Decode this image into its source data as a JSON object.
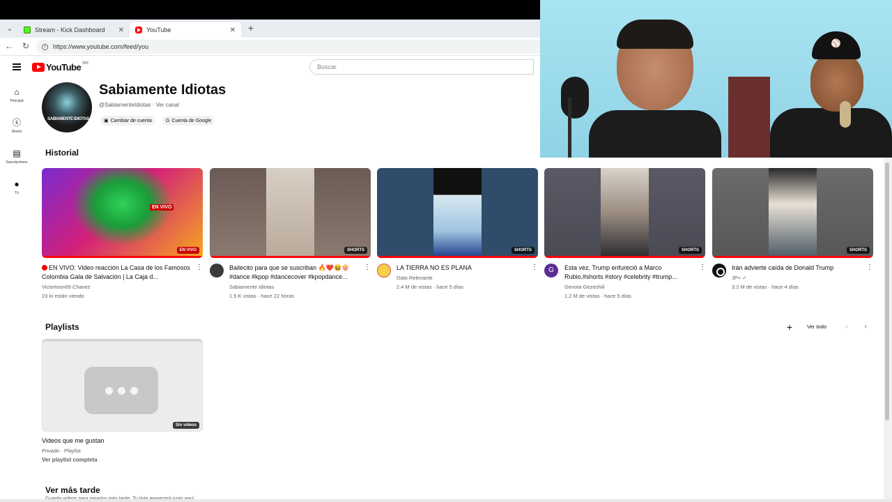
{
  "browser": {
    "tabs": [
      {
        "label": "Stream - Kick Dashboard",
        "active": false,
        "icon": "kick-favicon"
      },
      {
        "label": "YouTube",
        "active": true,
        "icon": "youtube-favicon"
      }
    ],
    "url": "https://www.youtube.com/feed/you"
  },
  "header": {
    "logo_text": "YouTube",
    "region": "MX",
    "search_placeholder": "Buscar"
  },
  "guide": {
    "items": [
      {
        "label": "Principal",
        "icon": "home-icon",
        "glyph": "⌂"
      },
      {
        "label": "Shorts",
        "icon": "shorts-icon",
        "glyph": "ⓢ"
      },
      {
        "label": "Suscripciones",
        "icon": "subscriptions-icon",
        "glyph": "▤"
      },
      {
        "label": "Tú",
        "icon": "account-icon",
        "glyph": "●"
      }
    ]
  },
  "channel": {
    "name": "Sabiamente Idiotas",
    "handle": "@SabiamenteIdiotas · Ver canal",
    "avatar_text": "SABIAMENTE IDIOTAS",
    "switch_account": "Cambiar de cuenta",
    "google_account": "Cuenta de Google"
  },
  "history": {
    "title": "Historial",
    "videos": [
      {
        "title": "EN VIVO: Video reacción La Casa de los Famosos Colombia Gala de Salvación | La Caja d...",
        "channel": "Victortoon69 Chavez",
        "meta": "23 lo están viendo",
        "badge": "EN VIVO",
        "thumb_top_text": "EN VIVO",
        "live": true,
        "progress_percent": 100
      },
      {
        "title": "Bailecito para que se suscriban 🔥❤️😆🍿 #dance #kpop #dancecover #kpopdance...",
        "channel": "Sabiamente Idiotas",
        "meta": "1.5 K vistas · hace 22 horas",
        "badge": "SHORTS",
        "live": false,
        "progress_percent": 100
      },
      {
        "title": "LA TIERRA NO ES PLANA",
        "channel": "Dato Relevante",
        "meta": "2.4 M de vistas · hace 5 días",
        "badge": "SHORTS",
        "live": false,
        "progress_percent": 100
      },
      {
        "title": "Esta vez, Trump enfureció a Marco Rubio.#shorts #story #celebrity #trump...",
        "channel": "Genota Gezeshili",
        "meta": "1.2 M de vistas · hace 5 días",
        "avatar_letter": "G",
        "badge": "SHORTS",
        "live": false,
        "progress_percent": 100
      },
      {
        "title": "Irán advierte caída de Donald Trump",
        "channel": "JP+ ✓",
        "meta": "3.2 M de vistas · hace 4 días",
        "badge": "SHORTS",
        "live": false,
        "progress_percent": 100
      }
    ]
  },
  "playlists": {
    "title": "Playlists",
    "view_all": "Ver todo",
    "items": [
      {
        "title": "Videos que me gustan",
        "meta": "Privado · Playlist",
        "link": "Ver playlist completa",
        "badge": "Sin videos"
      }
    ]
  },
  "watch_later": {
    "title": "Ver más tarde",
    "subtitle": "Guarda videos para mirarlos más tarde. Tu lista aparecerá justo aquí"
  },
  "colors": {
    "accent": "#ff0000",
    "live": "#cc0000",
    "text": "#0f0f0f",
    "secondary_text": "#606060"
  }
}
